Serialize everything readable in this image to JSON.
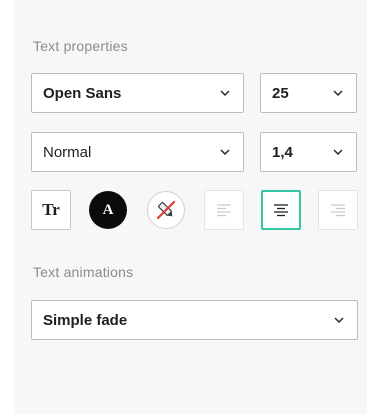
{
  "text_properties": {
    "label": "Text properties",
    "font_family": {
      "value": "Open Sans"
    },
    "font_size": {
      "value": "25"
    },
    "font_style": {
      "value": "Normal"
    },
    "line_height": {
      "value": "1,4"
    },
    "tools": {
      "text_case_glyph": "Tr",
      "text_color_glyph": "A",
      "text_color_value": "#0b0b0b",
      "accent_color": "#35c4a6",
      "align_selected": "center"
    }
  },
  "text_animations": {
    "label": "Text animations",
    "animation": {
      "value": "Simple fade"
    }
  }
}
